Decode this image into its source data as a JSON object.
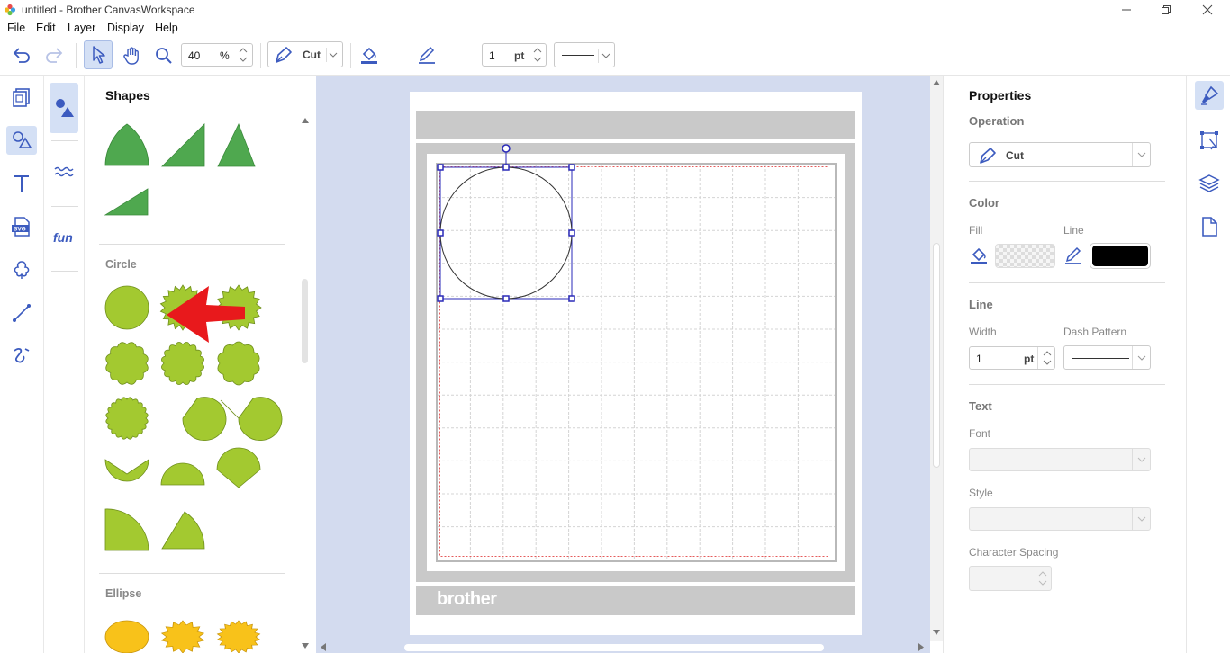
{
  "window": {
    "title": "untitled - Brother CanvasWorkspace",
    "minimize_icon": "minimize-icon",
    "restore_icon": "restore-icon",
    "close_icon": "close-icon"
  },
  "menu": [
    "File",
    "Edit",
    "Layer",
    "Display",
    "Help"
  ],
  "toolbar": {
    "zoom_value": "40",
    "zoom_unit": "%",
    "operation": "Cut",
    "line_width": "1",
    "line_unit": "pt",
    "fill_color": "transparent",
    "line_color": "#000000"
  },
  "shapes_panel": {
    "title": "Shapes",
    "sections": [
      {
        "label": "Circle"
      },
      {
        "label": "Ellipse"
      }
    ],
    "colors": {
      "triangle": "#4fa84f",
      "circle": "#a3c930",
      "ellipse": "#f8c21a"
    }
  },
  "canvas": {
    "brand": "brother",
    "mat_color": "#c9c9c9",
    "cut_area_color": "#e55b5b",
    "selection_color": "#2a2ab8"
  },
  "properties": {
    "title": "Properties",
    "operation_label": "Operation",
    "operation_value": "Cut",
    "color_label": "Color",
    "fill_label": "Fill",
    "line_label": "Line",
    "line_section": "Line",
    "width_label": "Width",
    "width_value": "1",
    "width_unit": "pt",
    "dash_label": "Dash Pattern",
    "text_section": "Text",
    "font_label": "Font",
    "style_label": "Style",
    "spacing_label": "Character Spacing",
    "line_color": "#000000"
  },
  "accent": "#3c5bbf"
}
